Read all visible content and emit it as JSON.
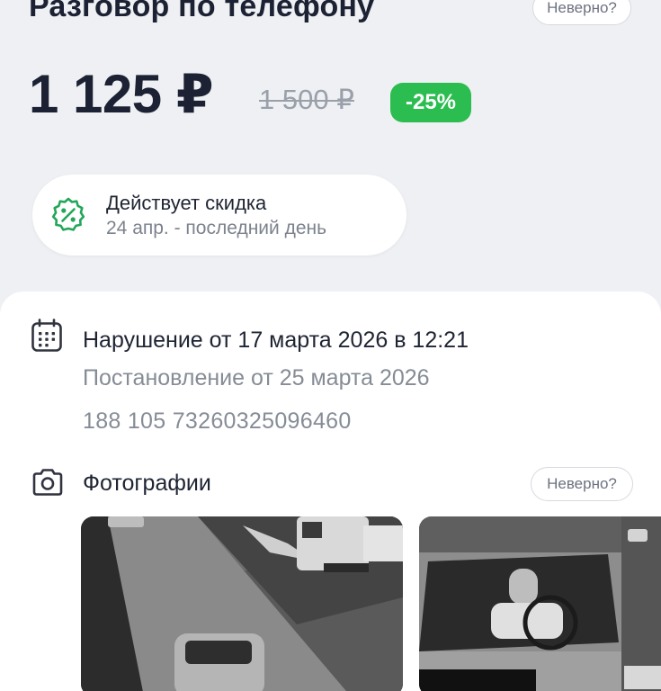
{
  "header": {
    "title": "Разговор по телефону",
    "wrong_label": "Неверно?"
  },
  "pricing": {
    "price": "1 125 ₽",
    "old_price": "1 500 ₽",
    "discount": "-25%",
    "discount_color": "#2bbd4f"
  },
  "promo": {
    "icon": "discount-icon",
    "title": "Действует скидка",
    "subtitle": "24 апр. - последний день"
  },
  "violation": {
    "icon": "calendar-icon",
    "title": "Нарушение от 17 марта 2026 в 12:21",
    "decree": "Постановление от 25 марта 2026",
    "uin": "188 105 73260325096460"
  },
  "photos": {
    "icon": "camera-icon",
    "label": "Фотографии",
    "wrong_label": "Неверно?"
  }
}
